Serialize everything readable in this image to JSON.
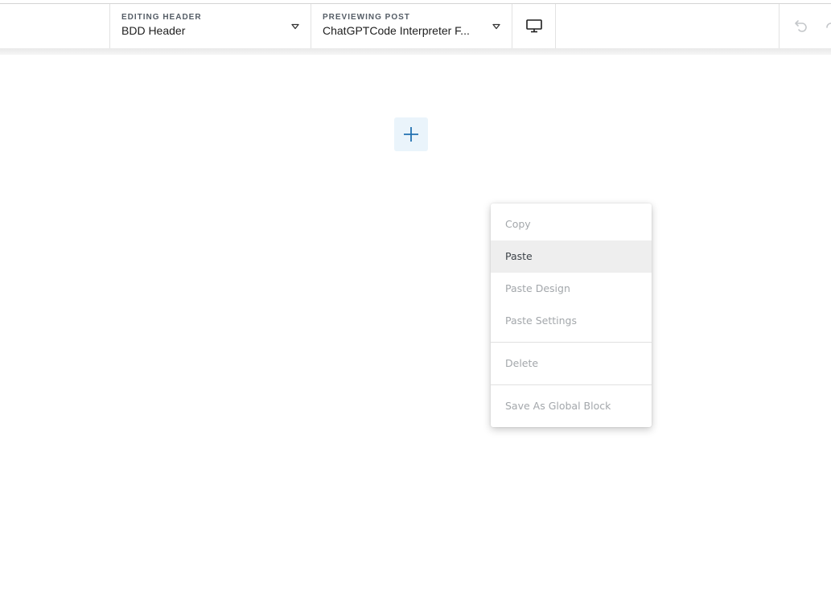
{
  "toolbar": {
    "editing": {
      "label": "EDITING HEADER",
      "value": "BDD Header"
    },
    "previewing": {
      "label": "PREVIEWING POST",
      "value": "ChatGPTCode Interpreter F..."
    },
    "device_icon": "desktop-icon",
    "undo_icon": "undo-icon",
    "redo_icon": "redo-icon"
  },
  "canvas": {
    "add_icon": "plus-icon",
    "accent_color": "#2271b1"
  },
  "context_menu": {
    "items": [
      {
        "label": "Copy"
      },
      {
        "label": "Paste"
      },
      {
        "label": "Paste Design"
      },
      {
        "label": "Paste Settings"
      },
      {
        "label": "Delete"
      },
      {
        "label": "Save As Global Block"
      }
    ],
    "highlighted": "Paste"
  }
}
